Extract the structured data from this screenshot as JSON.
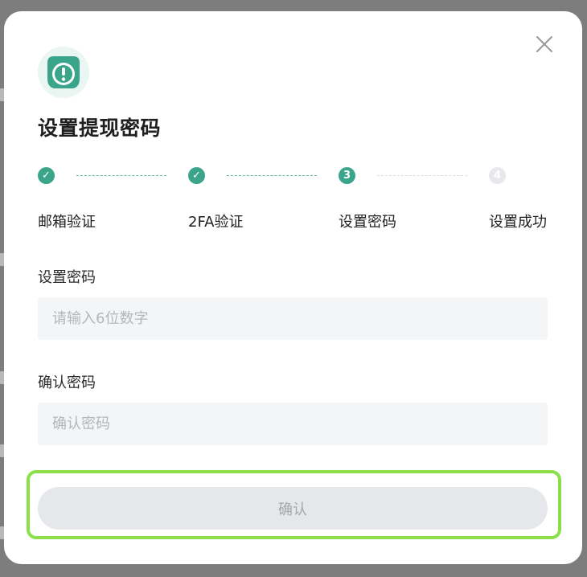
{
  "dialog": {
    "title": "设置提现密码",
    "close_icon": "close-icon",
    "header_icon": "alert-shield-icon"
  },
  "steps": [
    {
      "label": "邮箱验证",
      "status": "done",
      "marker": "✓"
    },
    {
      "label": "2FA验证",
      "status": "done",
      "marker": "✓"
    },
    {
      "label": "设置密码",
      "status": "current",
      "marker": "3"
    },
    {
      "label": "设置成功",
      "status": "todo",
      "marker": "4"
    }
  ],
  "form": {
    "password_label": "设置密码",
    "password_placeholder": "请输入6位数字",
    "confirm_label": "确认密码",
    "confirm_placeholder": "确认密码"
  },
  "confirm_button": {
    "label": "确认"
  },
  "colors": {
    "accent": "#3aa58a",
    "highlight": "#8be04a",
    "disabled_button": "#e6e7ea"
  }
}
